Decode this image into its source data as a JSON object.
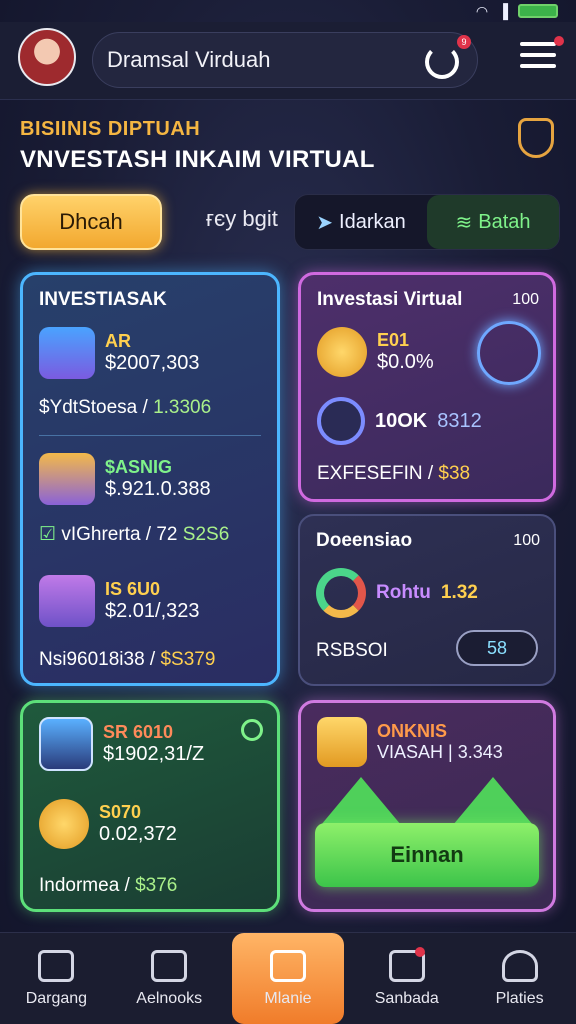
{
  "header": {
    "search_text": "Dramsal Virduah",
    "refresh_badge": "9"
  },
  "hero": {
    "subtitle": "BISIINIS DIPTUAH",
    "title": "VNVESTASH INKAIM VIRTUAL"
  },
  "filters": {
    "primary": "Dhcah",
    "plain": "ғєу bgit",
    "option_1": "Idarkan",
    "option_2": "Batah"
  },
  "card_investasak": {
    "title": "INVESTIASAK",
    "item1_label": "AR",
    "item1_value": "$2007,303",
    "line1_label": "$YdtStoesa /",
    "line1_value": "1.3306",
    "item2_label": "$ASNIG",
    "item2_value": "$.921.0.388",
    "line2_label": "vIGhrerta / 72",
    "line2_value": "S2S6",
    "item3_label": "IS 6U0",
    "item3_value": "$2.01/,323",
    "line3_label": "Nsi96018i38 /",
    "line3_value": "$S379"
  },
  "card_virtual": {
    "title": "Investasi Virtual",
    "count": "100",
    "item1_label": "E01",
    "item1_value": "$0.0%",
    "item2_label": "10OK",
    "item2_value": "8312",
    "footer_label": "EXFESEFIN /",
    "footer_value": "$38"
  },
  "card_doeensiao": {
    "title": "Doeensiao",
    "count": "100",
    "metric_label": "Rohtu",
    "metric_value": "1.32",
    "footer_label": "RSBSOI",
    "pill": "58"
  },
  "card_green": {
    "item1_label": "SR 6010",
    "item1_value": "$1902,31/Z",
    "item2_label": "S070",
    "item2_value": "0.02,372",
    "footer_label": "Indormea /",
    "footer_value": "$376"
  },
  "card_violet": {
    "label": "ONKNIS",
    "value_label": "VIASAH |",
    "value": "3.343",
    "button": "Einnan"
  },
  "tabs": [
    {
      "label": "Dargang",
      "icon": "home-icon"
    },
    {
      "label": "Aelnooks",
      "icon": "books-icon"
    },
    {
      "label": "Mlanie",
      "icon": "edit-icon"
    },
    {
      "label": "Sanbada",
      "icon": "camera-icon"
    },
    {
      "label": "Platies",
      "icon": "profile-icon"
    }
  ],
  "colors": {
    "accent_gold": "#f5b642",
    "accent_green": "#7ff28a",
    "accent_blue": "#4cb6ff",
    "accent_purple": "#d06ae0",
    "active_tab": "#f07c2a"
  }
}
